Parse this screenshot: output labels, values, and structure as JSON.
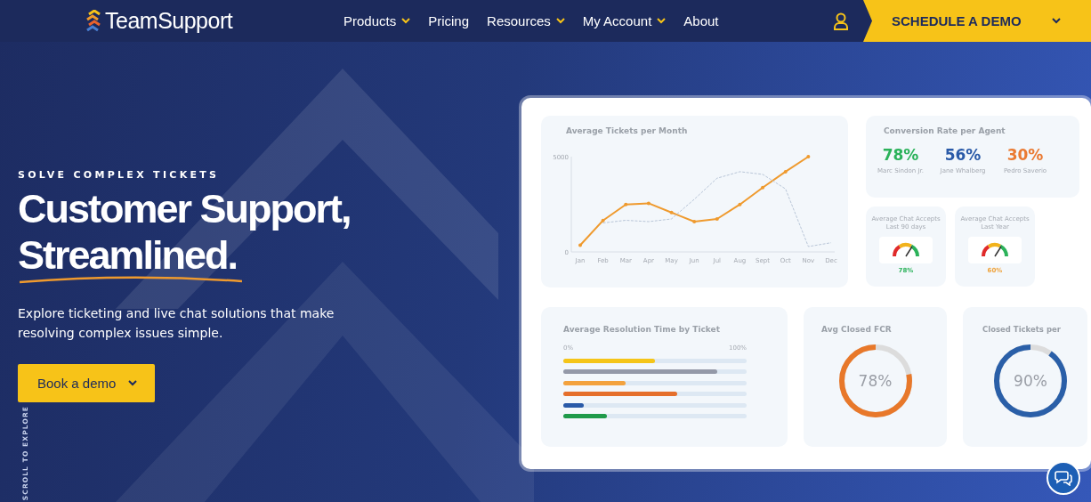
{
  "nav": {
    "logo": "TeamSupport",
    "links": [
      {
        "label": "Products",
        "dropdown": true
      },
      {
        "label": "Pricing",
        "dropdown": false
      },
      {
        "label": "Resources",
        "dropdown": true
      },
      {
        "label": "My Account",
        "dropdown": true
      },
      {
        "label": "About",
        "dropdown": false
      }
    ],
    "cta": "SCHEDULE A DEMO"
  },
  "hero": {
    "eyebrow": "SOLVE COMPLEX TICKETS",
    "title_lines": [
      "Customer Support,",
      "Streamlined."
    ],
    "description": "Explore ticketing and live chat solutions that make resolving complex issues simple.",
    "button": "Book a demo",
    "scroll_hint": "SCROLL TO EXPLORE"
  },
  "dashboard": {
    "tickets": {
      "title": "Average Tickets per Month",
      "chart_data": {
        "type": "line",
        "categories": [
          "Jan",
          "Feb",
          "Mar",
          "Apr",
          "May",
          "Jun",
          "Jul",
          "Aug",
          "Sept",
          "Oct",
          "Nov",
          "Dec"
        ],
        "yticks": [
          0,
          5000
        ],
        "ylim": [
          0,
          5000
        ],
        "series": [
          {
            "color": "#ef9a2e",
            "line_style": "solid",
            "values": [
              350,
              1650,
              2490,
              2550,
              2070,
              1590,
              1730,
              2490,
              3380,
              4210,
              5000,
              null
            ]
          },
          {
            "color": "#b9c6d8",
            "line_style": "dashed",
            "values": [
              null,
              1520,
              1660,
              1590,
              1730,
              2760,
              3870,
              4210,
              4070,
              3310,
              280,
              480
            ]
          }
        ]
      }
    },
    "conversion": {
      "title": "Conversion Rate per Agent",
      "agents": [
        {
          "value": "78%",
          "name": "Marc Sindon Jr.",
          "color": "#2bb25a"
        },
        {
          "value": "56%",
          "name": "Jane Whalberg",
          "color": "#2a5aa8"
        },
        {
          "value": "30%",
          "name": "Pedro Saverio",
          "color": "#ea7a32"
        }
      ]
    },
    "gauges": [
      {
        "title": "Average Chat Accepts Last 90 days",
        "reading": "78%",
        "color": "#2bb25a"
      },
      {
        "title": "Average Chat Accepts Last Year",
        "reading": "60%",
        "color": "#efa23a"
      }
    ],
    "resolution": {
      "title": "Average Resolution Time by Ticket",
      "min_label": "0%",
      "max_label": "100%",
      "bars": [
        {
          "level": 0.5,
          "color": "#f5c518"
        },
        {
          "level": 0.84,
          "color": "#9499a8"
        },
        {
          "level": 0.34,
          "color": "#f3a23e"
        },
        {
          "level": 0.62,
          "color": "#e56f2c"
        },
        {
          "level": 0.11,
          "color": "#2a5aa8"
        },
        {
          "level": 0.24,
          "color": "#1f9a4a"
        }
      ]
    },
    "donuts": [
      {
        "title": "Avg Closed FCR",
        "reading": "78%",
        "level": 0.78,
        "color": "#e8782a"
      },
      {
        "title": "Closed Tickets per",
        "reading": "90%",
        "level": 0.9,
        "color": "#2a5fa8"
      }
    ]
  }
}
